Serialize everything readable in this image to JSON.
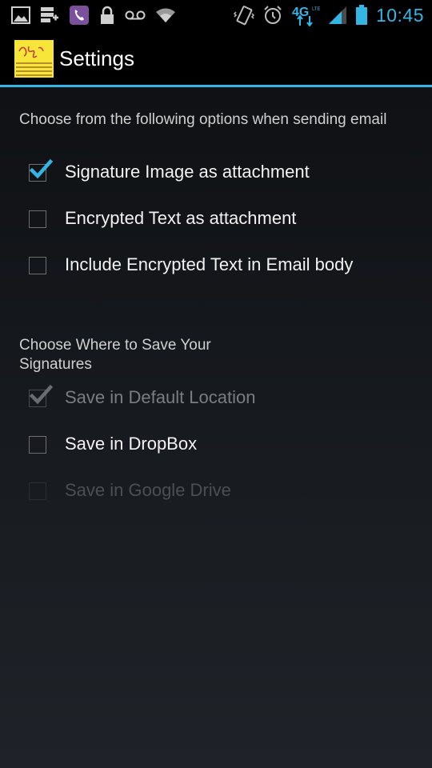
{
  "status_bar": {
    "time": "10:45",
    "network": "4G",
    "icons": [
      "picture-icon",
      "storage-icon",
      "viber-icon",
      "lock-icon",
      "voicemail-icon",
      "wifi-icon",
      "vibrate-icon",
      "alarm-icon",
      "network-4g-icon",
      "signal-icon",
      "battery-icon"
    ],
    "accent_color": "#33b5e5"
  },
  "action_bar": {
    "title": "Settings",
    "accent_color": "#33b5e5"
  },
  "email_section": {
    "header": "Choose from the following options when sending email",
    "options": [
      {
        "label": "Signature Image as attachment",
        "checked": true,
        "enabled": true
      },
      {
        "label": "Encrypted Text as attachment",
        "checked": false,
        "enabled": true
      },
      {
        "label": "Include Encrypted Text in Email body",
        "checked": false,
        "enabled": true
      }
    ]
  },
  "save_section": {
    "header": "Choose Where to Save Your Signatures",
    "options": [
      {
        "label": "Save in Default Location",
        "checked": true,
        "enabled": false
      },
      {
        "label": "Save in DropBox",
        "checked": false,
        "enabled": true
      },
      {
        "label": "Save in Google Drive",
        "checked": false,
        "enabled": false
      }
    ]
  }
}
